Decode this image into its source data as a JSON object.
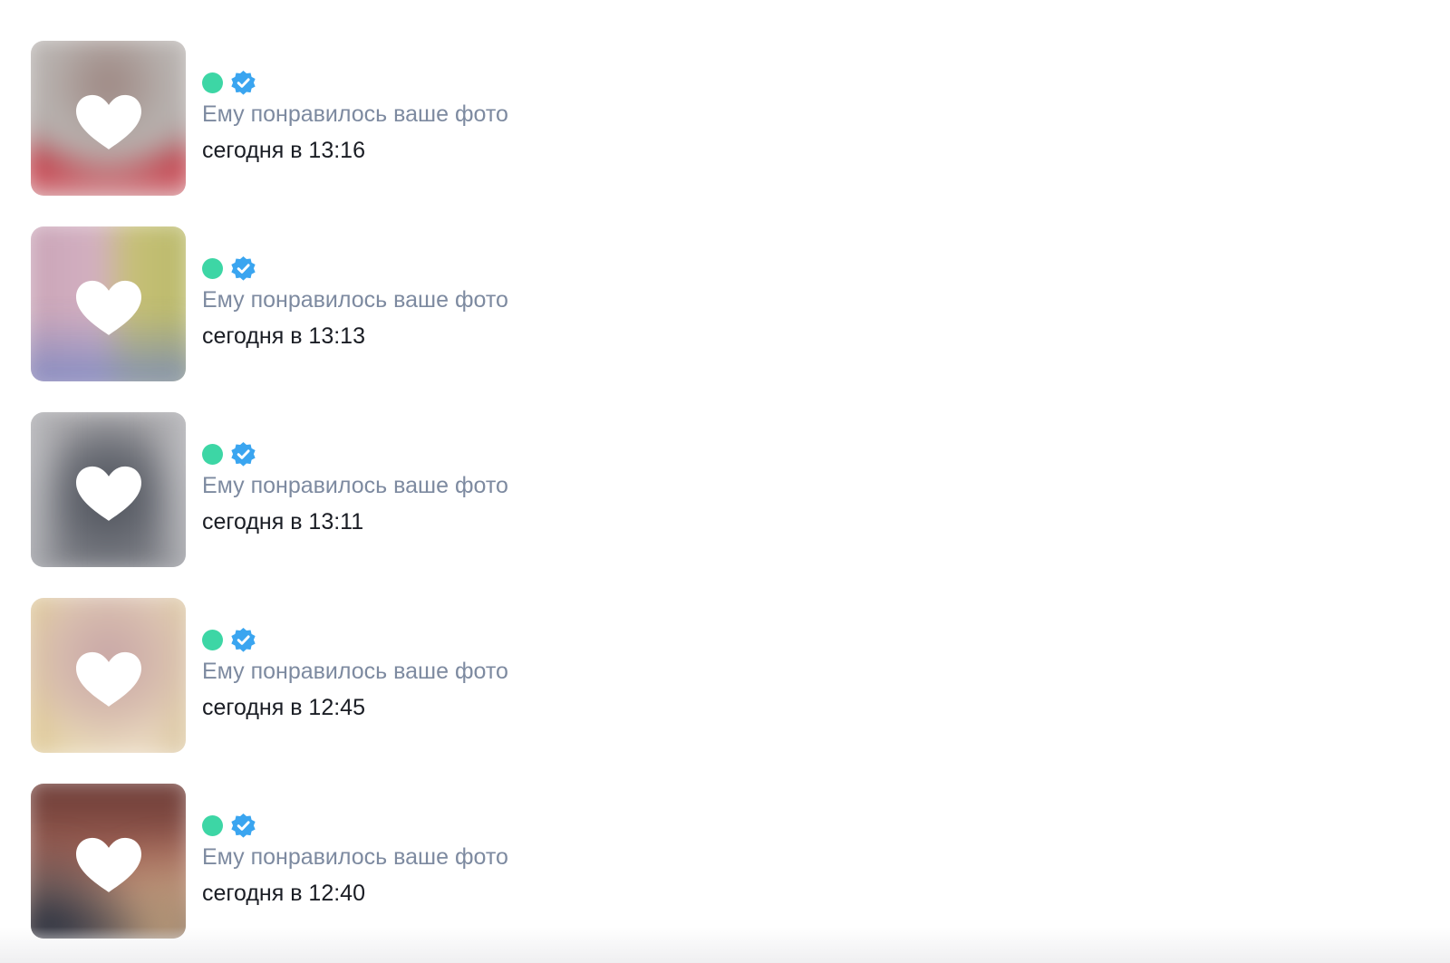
{
  "notifications": [
    {
      "icons": [
        "online-status-dot",
        "verified-badge-icon"
      ],
      "text": "Ему понравилось ваше фото",
      "time": "сегодня в 13:16",
      "photo_colors": [
        "#b9b4b1",
        "#8e7b76",
        "#c4303c"
      ]
    },
    {
      "icons": [
        "online-status-dot",
        "verified-badge-icon"
      ],
      "text": "Ему понравилось ваше фото",
      "time": "сегодня в 13:13",
      "photo_colors": [
        "#c9a4b6",
        "#c6c076",
        "#6d82c4"
      ]
    },
    {
      "icons": [
        "online-status-dot",
        "verified-badge-icon"
      ],
      "text": "Ему понравилось ваше фото",
      "time": "сегодня в 13:11",
      "photo_colors": [
        "#a9a8ab",
        "#5c5f68",
        "#bfc0c4"
      ]
    },
    {
      "icons": [
        "online-status-dot",
        "verified-badge-icon"
      ],
      "text": "Ему понравилось ваше фото",
      "time": "сегодня в 12:45",
      "photo_colors": [
        "#e8d9b5",
        "#c9a8a4",
        "#dcc48f"
      ]
    },
    {
      "icons": [
        "online-status-dot",
        "verified-badge-icon"
      ],
      "text": "Ему понравилось ваше фото",
      "time": "сегодня в 12:40",
      "photo_colors": [
        "#6b3a35",
        "#b88a76",
        "#2e3442"
      ]
    }
  ],
  "colors": {
    "online": "#3dd6a5",
    "verified": "#3aa5f0",
    "secondary_text": "#7d8aa0",
    "primary_text": "#1a1d24"
  }
}
